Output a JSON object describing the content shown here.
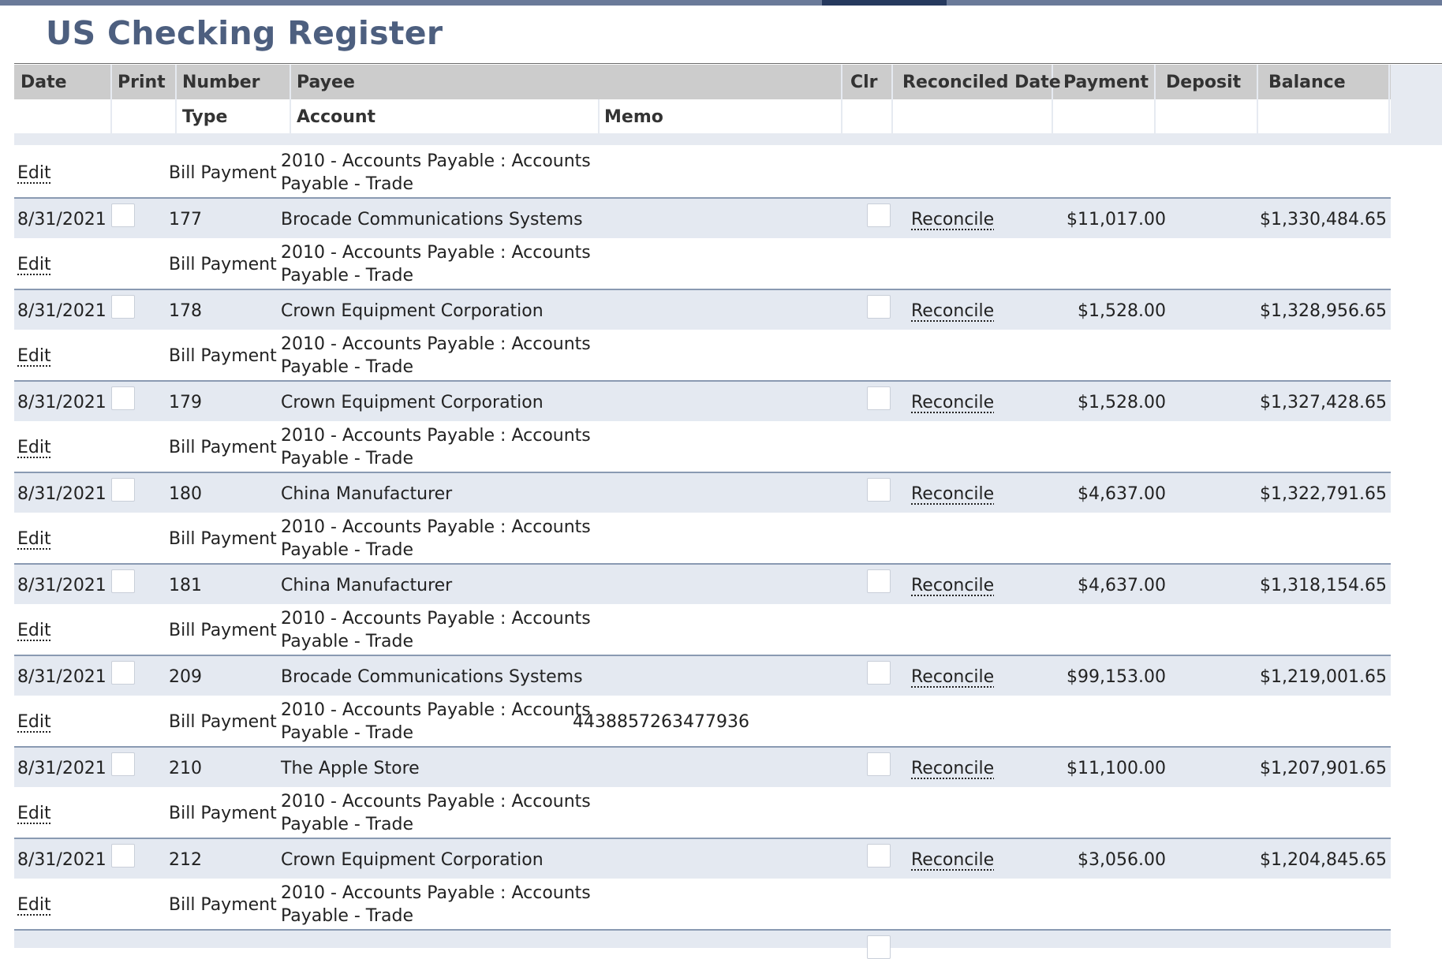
{
  "page": {
    "title": "US Checking Register"
  },
  "header": {
    "row1": {
      "date": "Date",
      "print": "Print",
      "number": "Number",
      "payee": "Payee",
      "clr": "Clr",
      "reconciled_date": "Reconciled Date",
      "payment": "Payment",
      "deposit": "Deposit",
      "balance": "Balance"
    },
    "row2": {
      "type": "Type",
      "account": "Account",
      "memo": "Memo"
    }
  },
  "labels": {
    "edit": "Edit",
    "reconcile": "Reconcile"
  },
  "rows": [
    {
      "edit": {
        "type": "Bill Payment",
        "account_line1": "2010 - Accounts Payable : Accounts",
        "account_line2": "Payable - Trade",
        "memo": ""
      },
      "tx": {
        "date": "8/31/2021",
        "number": "177",
        "payee": "Brocade Communications Systems",
        "payment": "$11,017.00",
        "balance": "$1,330,484.65"
      }
    },
    {
      "edit": {
        "type": "Bill Payment",
        "account_line1": "2010 - Accounts Payable : Accounts",
        "account_line2": "Payable - Trade",
        "memo": ""
      },
      "tx": {
        "date": "8/31/2021",
        "number": "178",
        "payee": "Crown Equipment Corporation",
        "payment": "$1,528.00",
        "balance": "$1,328,956.65"
      }
    },
    {
      "edit": {
        "type": "Bill Payment",
        "account_line1": "2010 - Accounts Payable : Accounts",
        "account_line2": "Payable - Trade",
        "memo": ""
      },
      "tx": {
        "date": "8/31/2021",
        "number": "179",
        "payee": "Crown Equipment Corporation",
        "payment": "$1,528.00",
        "balance": "$1,327,428.65"
      }
    },
    {
      "edit": {
        "type": "Bill Payment",
        "account_line1": "2010 - Accounts Payable : Accounts",
        "account_line2": "Payable - Trade",
        "memo": ""
      },
      "tx": {
        "date": "8/31/2021",
        "number": "180",
        "payee": "China Manufacturer",
        "payment": "$4,637.00",
        "balance": "$1,322,791.65"
      }
    },
    {
      "edit": {
        "type": "Bill Payment",
        "account_line1": "2010 - Accounts Payable : Accounts",
        "account_line2": "Payable - Trade",
        "memo": ""
      },
      "tx": {
        "date": "8/31/2021",
        "number": "181",
        "payee": "China Manufacturer",
        "payment": "$4,637.00",
        "balance": "$1,318,154.65"
      }
    },
    {
      "edit": {
        "type": "Bill Payment",
        "account_line1": "2010 - Accounts Payable : Accounts",
        "account_line2": "Payable - Trade",
        "memo": ""
      },
      "tx": {
        "date": "8/31/2021",
        "number": "209",
        "payee": "Brocade Communications Systems",
        "payment": "$99,153.00",
        "balance": "$1,219,001.65"
      }
    },
    {
      "edit": {
        "type": "Bill Payment",
        "account_line1": "2010 - Accounts Payable : Accounts",
        "account_line2": "Payable - Trade",
        "memo": "4438857263477936"
      },
      "tx": {
        "date": "8/31/2021",
        "number": "210",
        "payee": "The Apple Store",
        "payment": "$11,100.00",
        "balance": "$1,207,901.65"
      }
    },
    {
      "edit": {
        "type": "Bill Payment",
        "account_line1": "2010 - Accounts Payable : Accounts",
        "account_line2": "Payable - Trade",
        "memo": ""
      },
      "tx": {
        "date": "8/31/2021",
        "number": "212",
        "payee": "Crown Equipment Corporation",
        "payment": "$3,056.00",
        "balance": "$1,204,845.65"
      }
    },
    {
      "edit": {
        "type": "Bill Payment",
        "account_line1": "2010 - Accounts Payable : Accounts",
        "account_line2": "Payable - Trade",
        "memo": ""
      },
      "tx": null
    }
  ]
}
